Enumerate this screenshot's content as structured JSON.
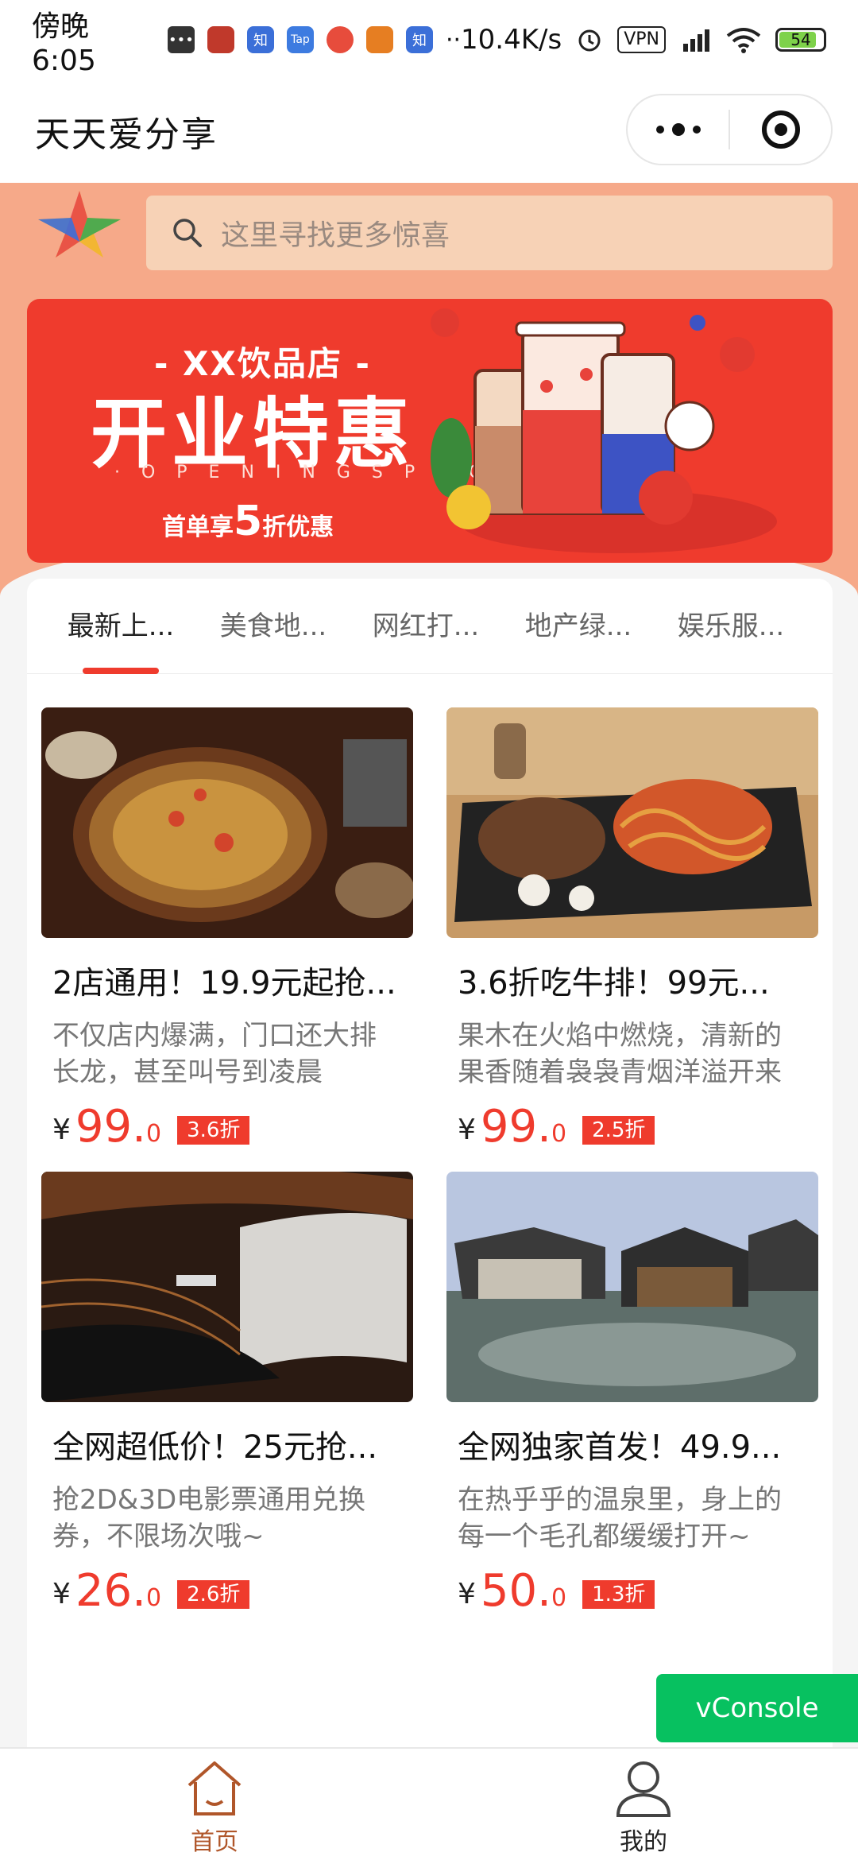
{
  "status_bar": {
    "time": "傍晚6:05",
    "net_speed": "10.4K/s",
    "vpn": "VPN",
    "battery": "54",
    "app_icons": [
      "chat-icon",
      "game-icon",
      "zhihu-icon",
      "tap-icon",
      "app-icon",
      "app-icon",
      "zhihu-icon"
    ],
    "app_labels": [
      "…",
      "",
      "知",
      "Tap",
      "",
      "",
      "知"
    ]
  },
  "navbar": {
    "title": "天天爱分享"
  },
  "search": {
    "placeholder": "这里寻找更多惊喜"
  },
  "banner": {
    "store": "- XX饮品店 -",
    "headline": "开业特惠",
    "subtitle": "· O P E N I N G   S P E C I A L ·",
    "offer_prefix": "首单享",
    "offer_number": "5",
    "offer_suffix": "折优惠"
  },
  "tabs": [
    {
      "label": "最新上...",
      "active": true
    },
    {
      "label": "美食地...",
      "active": false
    },
    {
      "label": "网红打...",
      "active": false
    },
    {
      "label": "地产绿...",
      "active": false
    },
    {
      "label": "娱乐服...",
      "active": false
    }
  ],
  "items": [
    {
      "name": "2店通用！19.9元起抢...",
      "desc": "不仅店内爆满，门口还大排长龙，甚至叫号到凌晨",
      "currency": "¥",
      "price_int": "99.",
      "price_dec": "0",
      "discount": "3.6折",
      "image": "hotpot-photo"
    },
    {
      "name": "3.6折吃牛排！99元...",
      "desc": "果木在火焰中燃烧，清新的果香随着袅袅青烟洋溢开来",
      "currency": "¥",
      "price_int": "99.",
      "price_dec": "0",
      "discount": "2.5折",
      "image": "steak-photo"
    },
    {
      "name": "全网超低价！25元抢...",
      "desc": "抢2D&3D电影票通用兑换券，不限场次哦~",
      "currency": "¥",
      "price_int": "26.",
      "price_dec": "0",
      "discount": "2.6折",
      "image": "cinema-photo"
    },
    {
      "name": "全网独家首发！49.9...",
      "desc": "在热乎乎的温泉里，身上的每一个毛孔都缓缓打开~",
      "currency": "¥",
      "price_int": "50.",
      "price_dec": "0",
      "discount": "1.3折",
      "image": "hotspring-photo"
    }
  ],
  "vconsole": {
    "label": "vConsole"
  },
  "tabbar": {
    "home": {
      "label": "首页",
      "icon": "home-icon"
    },
    "mine": {
      "label": "我的",
      "icon": "user-icon"
    }
  },
  "colors": {
    "accent": "#ef3b2d",
    "hero": "#f6a989",
    "search_bg": "#f7d2b6",
    "vconsole": "#07c160",
    "tab_active": "#b0562a"
  }
}
